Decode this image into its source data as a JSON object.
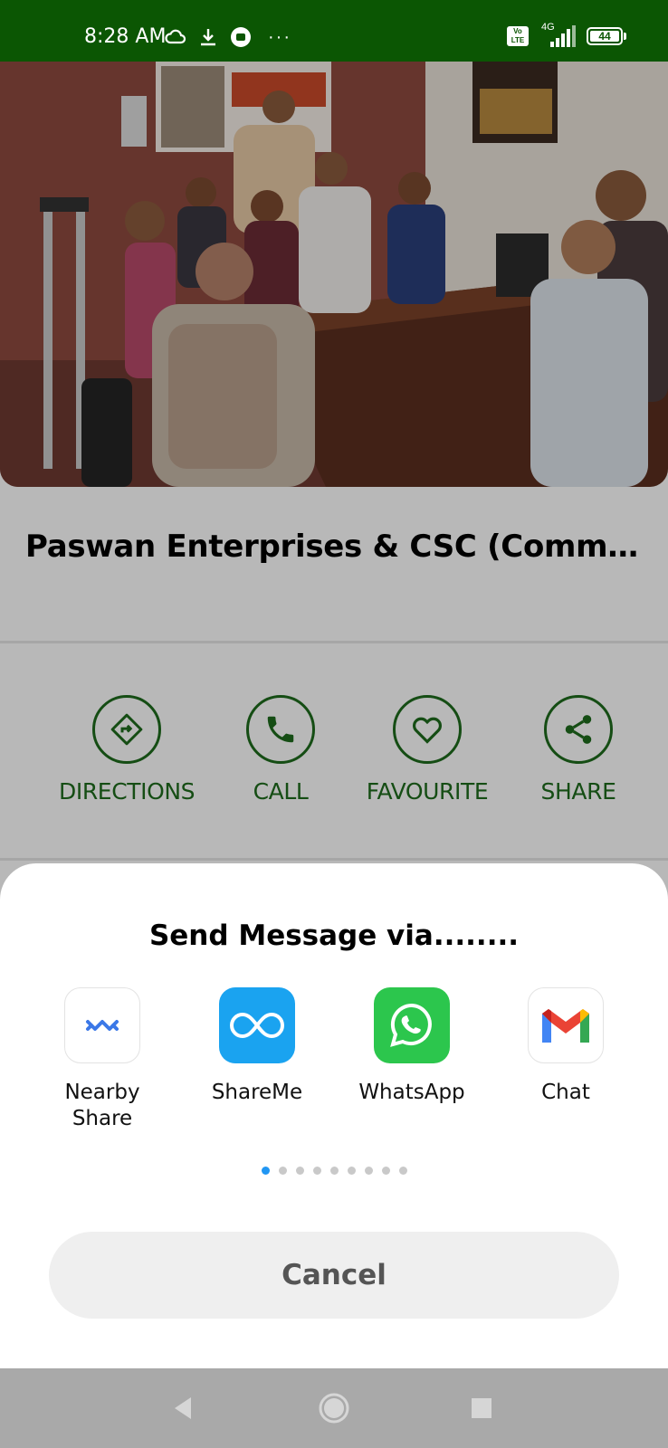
{
  "status_bar": {
    "time": "8:28 AM",
    "network": "4G",
    "volte": "Vo LTE",
    "battery": "44",
    "more": "···"
  },
  "business": {
    "title": "Paswan Enterprises & CSC (Common S…"
  },
  "actions": [
    {
      "label": "DIRECTIONS",
      "icon": "directions-icon"
    },
    {
      "label": "CALL",
      "icon": "phone-icon"
    },
    {
      "label": "FAVOURITE",
      "icon": "heart-icon"
    },
    {
      "label": "SHARE",
      "icon": "share-icon"
    }
  ],
  "share_sheet": {
    "title": "Send Message via........",
    "apps": [
      {
        "label": "Nearby\nShare",
        "icon": "nearby-share-icon"
      },
      {
        "label": "ShareMe",
        "icon": "shareme-icon"
      },
      {
        "label": "WhatsApp",
        "icon": "whatsapp-icon"
      },
      {
        "label": "Chat",
        "icon": "gmail-icon"
      }
    ],
    "pages_total": 9,
    "page_active": 1,
    "cancel_label": "Cancel"
  },
  "colors": {
    "status_bar": "#0b5603",
    "accent_green": "#1e6b1c",
    "page_indicator_active": "#2196f3"
  }
}
